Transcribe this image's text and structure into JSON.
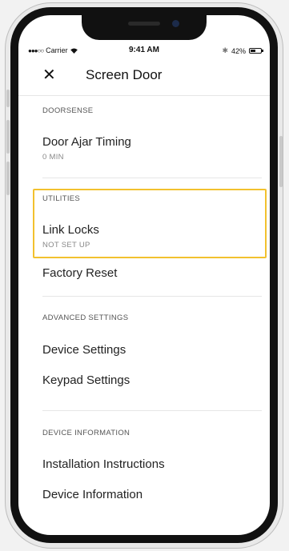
{
  "status_bar": {
    "carrier_dots": "●●●○○",
    "carrier": "Carrier",
    "time": "9:41 AM",
    "bluetooth": "✱",
    "battery": "42%"
  },
  "header": {
    "close_glyph": "✕",
    "title": "Screen Door"
  },
  "sections": {
    "doorsense": {
      "label": "DOORSENSE",
      "ajar_title": "Door Ajar Timing",
      "ajar_value": "0 MIN"
    },
    "utilities": {
      "label": "UTILITIES",
      "link_title": "Link Locks",
      "link_value": "NOT SET UP",
      "factory_reset": "Factory Reset"
    },
    "advanced": {
      "label": "ADVANCED SETTINGS",
      "device_settings": "Device Settings",
      "keypad_settings": "Keypad Settings"
    },
    "device_info": {
      "label": "DEVICE INFORMATION",
      "installation": "Installation Instructions",
      "device_information": "Device Information"
    }
  },
  "colors": {
    "highlight": "#f2c12e",
    "text_primary": "#222222",
    "text_secondary": "#888888"
  }
}
